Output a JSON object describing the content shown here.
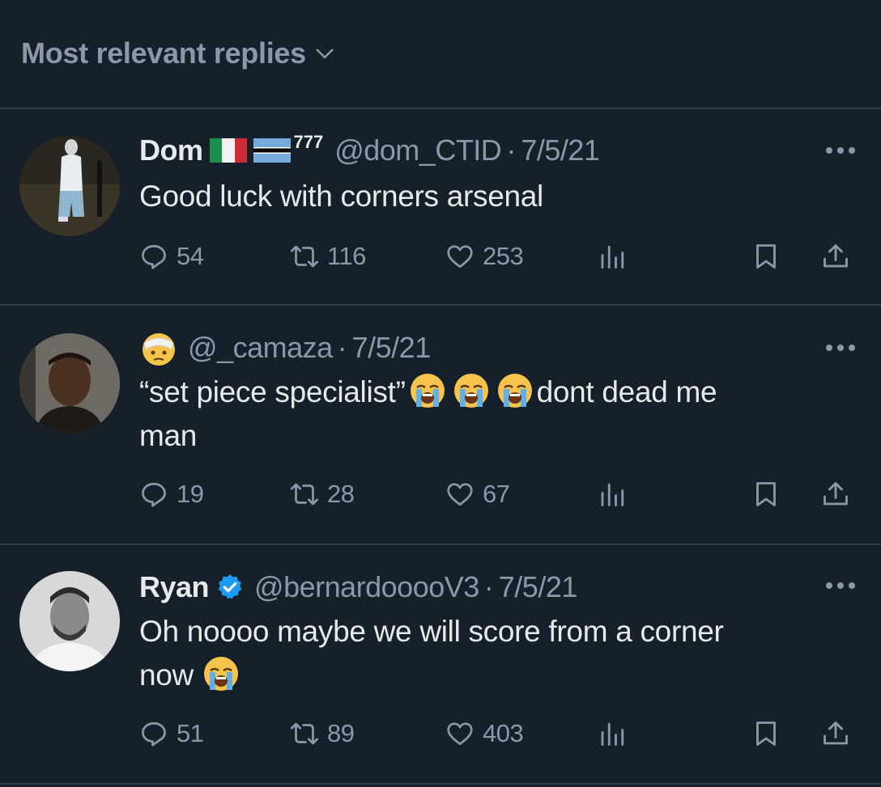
{
  "sort": {
    "label": "Most relevant replies"
  },
  "replies": [
    {
      "name": "Dom",
      "handle_suffix": "777",
      "handle": "@dom_CTID",
      "date": "7/5/21",
      "text": "Good luck with corners arsenal",
      "text_line2": "",
      "stats": {
        "replies": "54",
        "reposts": "116",
        "likes": "253"
      }
    },
    {
      "name": "",
      "handle": "@_camaza",
      "date": "7/5/21",
      "text": "“set piece specialist”",
      "text_after_emoji": "dont dead me",
      "text_line2": "man",
      "stats": {
        "replies": "19",
        "reposts": "28",
        "likes": "67"
      }
    },
    {
      "name": "Ryan",
      "handle": "@bernardooooV3",
      "date": "7/5/21",
      "text": "Oh noooo maybe we will score from a corner",
      "text_line2": "now",
      "stats": {
        "replies": "51",
        "reposts": "89",
        "likes": "403"
      }
    }
  ],
  "separator": "·",
  "icons": {
    "sort": "chevron-down-icon",
    "more": "more-horizontal-icon",
    "reply": "reply-icon",
    "repost": "repost-icon",
    "like": "heart-icon",
    "views": "views-icon",
    "bookmark": "bookmark-icon",
    "share": "share-icon",
    "verified": "verified-badge-icon",
    "emoji": "loudly-crying-face-emoji",
    "user_emoji": "face-with-head-bandage-emoji"
  },
  "colors": {
    "background": "#15202b",
    "text": "#e7e9ea",
    "muted": "#8b98a5",
    "verified": "#1d9bf0",
    "divider": "#2f3b47"
  }
}
